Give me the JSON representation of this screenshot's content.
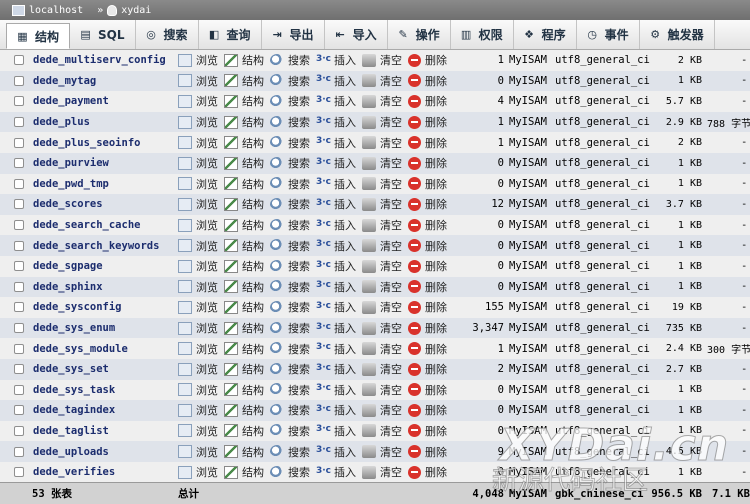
{
  "breadcrumb": {
    "server": "localhost",
    "separator": "»",
    "database": "xydai"
  },
  "tabs": [
    {
      "label": "结构",
      "icon": "structure-icon"
    },
    {
      "label": "SQL",
      "icon": "sql-icon"
    },
    {
      "label": "搜索",
      "icon": "search-icon"
    },
    {
      "label": "查询",
      "icon": "query-icon"
    },
    {
      "label": "导出",
      "icon": "export-icon"
    },
    {
      "label": "导入",
      "icon": "import-icon"
    },
    {
      "label": "操作",
      "icon": "wrench-icon"
    },
    {
      "label": "权限",
      "icon": "privileges-icon"
    },
    {
      "label": "程序",
      "icon": "routines-icon"
    },
    {
      "label": "事件",
      "icon": "clock-icon"
    },
    {
      "label": "触发器",
      "icon": "triggers-icon"
    }
  ],
  "actions": {
    "browse": "浏览",
    "structure": "结构",
    "search": "搜索",
    "insert": "插入",
    "empty": "清空",
    "drop": "删除"
  },
  "rows": [
    {
      "name": "dede_multiserv_config",
      "rows": "1",
      "engine": "MyISAM",
      "collation": "utf8_general_ci",
      "size": "2 KB",
      "overhead": "-"
    },
    {
      "name": "dede_mytag",
      "rows": "0",
      "engine": "MyISAM",
      "collation": "utf8_general_ci",
      "size": "1 KB",
      "overhead": "-"
    },
    {
      "name": "dede_payment",
      "rows": "4",
      "engine": "MyISAM",
      "collation": "utf8_general_ci",
      "size": "5.7 KB",
      "overhead": "-"
    },
    {
      "name": "dede_plus",
      "rows": "1",
      "engine": "MyISAM",
      "collation": "utf8_general_ci",
      "size": "2.9 KB",
      "overhead": "788 字节"
    },
    {
      "name": "dede_plus_seoinfo",
      "rows": "1",
      "engine": "MyISAM",
      "collation": "utf8_general_ci",
      "size": "2 KB",
      "overhead": "-"
    },
    {
      "name": "dede_purview",
      "rows": "0",
      "engine": "MyISAM",
      "collation": "utf8_general_ci",
      "size": "1 KB",
      "overhead": "-"
    },
    {
      "name": "dede_pwd_tmp",
      "rows": "0",
      "engine": "MyISAM",
      "collation": "utf8_general_ci",
      "size": "1 KB",
      "overhead": "-"
    },
    {
      "name": "dede_scores",
      "rows": "12",
      "engine": "MyISAM",
      "collation": "utf8_general_ci",
      "size": "3.7 KB",
      "overhead": "-"
    },
    {
      "name": "dede_search_cache",
      "rows": "0",
      "engine": "MyISAM",
      "collation": "utf8_general_ci",
      "size": "1 KB",
      "overhead": "-"
    },
    {
      "name": "dede_search_keywords",
      "rows": "0",
      "engine": "MyISAM",
      "collation": "utf8_general_ci",
      "size": "1 KB",
      "overhead": "-"
    },
    {
      "name": "dede_sgpage",
      "rows": "0",
      "engine": "MyISAM",
      "collation": "utf8_general_ci",
      "size": "1 KB",
      "overhead": "-"
    },
    {
      "name": "dede_sphinx",
      "rows": "0",
      "engine": "MyISAM",
      "collation": "utf8_general_ci",
      "size": "1 KB",
      "overhead": "-"
    },
    {
      "name": "dede_sysconfig",
      "rows": "155",
      "engine": "MyISAM",
      "collation": "utf8_general_ci",
      "size": "19 KB",
      "overhead": "-"
    },
    {
      "name": "dede_sys_enum",
      "rows": "3,347",
      "engine": "MyISAM",
      "collation": "utf8_general_ci",
      "size": "735 KB",
      "overhead": "-"
    },
    {
      "name": "dede_sys_module",
      "rows": "1",
      "engine": "MyISAM",
      "collation": "utf8_general_ci",
      "size": "2.4 KB",
      "overhead": "300 字节"
    },
    {
      "name": "dede_sys_set",
      "rows": "2",
      "engine": "MyISAM",
      "collation": "utf8_general_ci",
      "size": "2.7 KB",
      "overhead": "-"
    },
    {
      "name": "dede_sys_task",
      "rows": "0",
      "engine": "MyISAM",
      "collation": "utf8_general_ci",
      "size": "1 KB",
      "overhead": "-"
    },
    {
      "name": "dede_tagindex",
      "rows": "0",
      "engine": "MyISAM",
      "collation": "utf8_general_ci",
      "size": "1 KB",
      "overhead": "-"
    },
    {
      "name": "dede_taglist",
      "rows": "0",
      "engine": "MyISAM",
      "collation": "utf8_general_ci",
      "size": "1 KB",
      "overhead": "-"
    },
    {
      "name": "dede_uploads",
      "rows": "9",
      "engine": "MyISAM",
      "collation": "utf8_general_ci",
      "size": "4.5 KB",
      "overhead": "-"
    },
    {
      "name": "dede_verifies",
      "rows": "0",
      "engine": "MyISAM",
      "collation": "utf8_general_ci",
      "size": "1 KB",
      "overhead": "-"
    }
  ],
  "footer": {
    "count": "53 张表",
    "sum_label": "总计",
    "rows": "4,048",
    "engine": "MyISAM",
    "collation": "gbk_chinese_ci",
    "size": "956.5 KB",
    "overhead": "7.1 KB"
  },
  "watermark": {
    "line1": "XYDai.cn",
    "line2": "新源代码社区"
  },
  "colors": {
    "row_odd": "#efefef",
    "row_even": "#dfe3ea",
    "table_name": "#1c2d6e"
  }
}
